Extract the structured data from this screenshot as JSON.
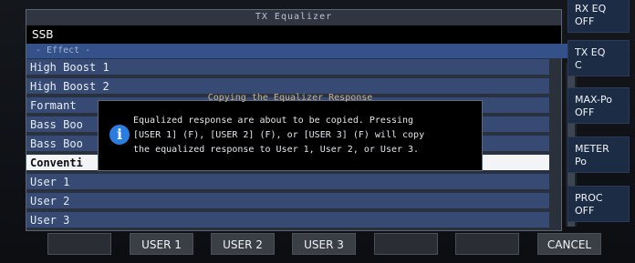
{
  "panel": {
    "title": "TX Equalizer",
    "mode": "SSB",
    "effect_header": "- Effect -",
    "rows": [
      {
        "label": "High Boost 1"
      },
      {
        "label": "High Boost 2"
      },
      {
        "label": "Formant"
      },
      {
        "label": "Bass Boo"
      },
      {
        "label": "Bass Boo"
      },
      {
        "label": "Conventi"
      },
      {
        "label": "User 1"
      },
      {
        "label": "User 2"
      },
      {
        "label": "User 3"
      }
    ],
    "selected_index": 5
  },
  "dialog": {
    "title": "Copying the Equalizer Response",
    "icon": "info-icon",
    "text": "Equalized response are about to be copied. Pressing\n[USER 1] (F), [USER 2] (F), or [USER 3] (F) will copy\nthe equalized response to User 1, User 2, or User 3."
  },
  "right_buttons": [
    {
      "label": "RX EQ\nOFF"
    },
    {
      "label": "TX EQ\nC"
    },
    {
      "label": "MAX-Po\nOFF"
    },
    {
      "label": "METER\nPo"
    },
    {
      "label": "PROC\nOFF"
    }
  ],
  "bottom_buttons": [
    {
      "label": ""
    },
    {
      "label": "USER 1"
    },
    {
      "label": "USER 2"
    },
    {
      "label": "USER 3"
    },
    {
      "label": ""
    },
    {
      "label": ""
    },
    {
      "label": "CANCEL"
    }
  ],
  "colors": {
    "accent": "#364a73",
    "selected": "#f2f4f6",
    "dialog_bg": "#000000",
    "info_icon": "#2a7de0"
  }
}
